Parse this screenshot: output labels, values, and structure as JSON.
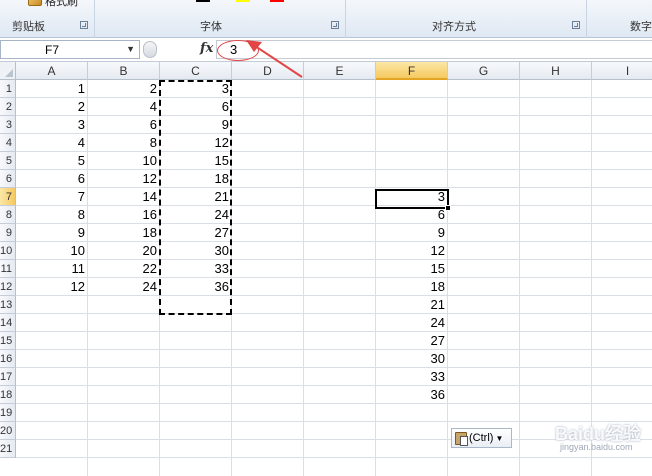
{
  "ribbon": {
    "format_painter_label": "格式刷",
    "groups": [
      {
        "label": "剪贴板"
      },
      {
        "label": "字体"
      },
      {
        "label": "对齐方式"
      },
      {
        "label": "数字"
      }
    ]
  },
  "formula_bar": {
    "name_box": "F7",
    "fx_label": "fx",
    "value": "3"
  },
  "sheet": {
    "columns": [
      "A",
      "B",
      "C",
      "D",
      "E",
      "F",
      "G",
      "H",
      "I"
    ],
    "active_column": "F",
    "active_row": "7",
    "row_numbers": [
      "1",
      "2",
      "3",
      "4",
      "5",
      "6",
      "7",
      "8",
      "9",
      "10",
      "11",
      "12",
      "13",
      "14",
      "15",
      "16",
      "17",
      "18",
      "19",
      "20",
      "21"
    ],
    "col_A": [
      "1",
      "2",
      "3",
      "4",
      "5",
      "6",
      "7",
      "8",
      "9",
      "10",
      "11",
      "12"
    ],
    "col_B": [
      "2",
      "4",
      "6",
      "8",
      "10",
      "12",
      "14",
      "16",
      "18",
      "20",
      "22",
      "24"
    ],
    "col_C": [
      "3",
      "6",
      "9",
      "12",
      "15",
      "18",
      "21",
      "24",
      "27",
      "30",
      "33",
      "36"
    ],
    "col_F": [
      "3",
      "6",
      "9",
      "12",
      "15",
      "18",
      "21",
      "24",
      "27",
      "30",
      "33",
      "36"
    ],
    "col_F_start_row": 7
  },
  "paste_options": {
    "label": "(Ctrl)"
  },
  "watermark": {
    "text": "Baidu经验",
    "sub": "jingyan.baidu.com"
  },
  "annotation_color": "#e34545",
  "accent_active_header": "#f5c960"
}
